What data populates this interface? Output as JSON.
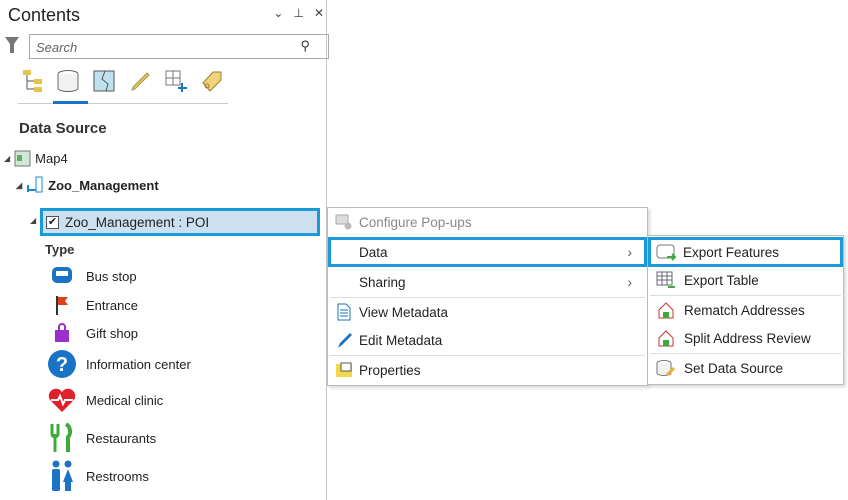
{
  "panel": {
    "title": "Contents",
    "search_placeholder": "Search",
    "section": "Data Source",
    "tree": {
      "map": "Map4",
      "database": "Zoo_Management",
      "layer": "Zoo_Management : POI",
      "type_heading": "Type"
    },
    "legend": [
      {
        "label": "Bus stop",
        "icon": "bus-icon"
      },
      {
        "label": "Entrance",
        "icon": "flag-icon"
      },
      {
        "label": "Gift shop",
        "icon": "shopping-bag-icon"
      },
      {
        "label": "Information center",
        "icon": "question-icon"
      },
      {
        "label": "Medical clinic",
        "icon": "heart-icon"
      },
      {
        "label": "Restaurants",
        "icon": "fork-knife-icon"
      },
      {
        "label": "Restrooms",
        "icon": "restroom-icon"
      }
    ]
  },
  "context_menu": {
    "items": [
      "Configure Pop-ups",
      "Data",
      "Sharing",
      "View Metadata",
      "Edit Metadata",
      "Properties"
    ]
  },
  "submenu": {
    "items": [
      "Export Features",
      "Export Table",
      "Rematch Addresses",
      "Split Address Review",
      "Set Data Source"
    ]
  },
  "colors": {
    "accent": "#1a9ad6",
    "selection": "#cde0f0"
  }
}
